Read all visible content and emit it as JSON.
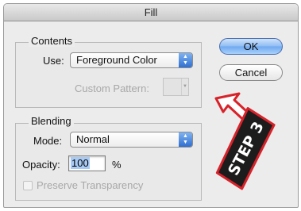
{
  "window": {
    "title": "Fill"
  },
  "contents": {
    "group_label": "Contents",
    "use_label": "Use:",
    "use_value": "Foreground Color",
    "custom_pattern_label": "Custom Pattern:"
  },
  "blending": {
    "group_label": "Blending",
    "mode_label": "Mode:",
    "mode_value": "Normal",
    "opacity_label": "Opacity:",
    "opacity_value": "100",
    "opacity_unit": "%",
    "preserve_label": "Preserve Transparency",
    "preserve_checked": false
  },
  "buttons": {
    "ok": "OK",
    "cancel": "Cancel"
  },
  "annotation": {
    "text": "STEP 3",
    "arrow_color": "#d8222a",
    "badge_color": "#1c1c1c"
  },
  "colors": {
    "accent": "#6ea8f0",
    "selection": "#a8cbf5"
  }
}
